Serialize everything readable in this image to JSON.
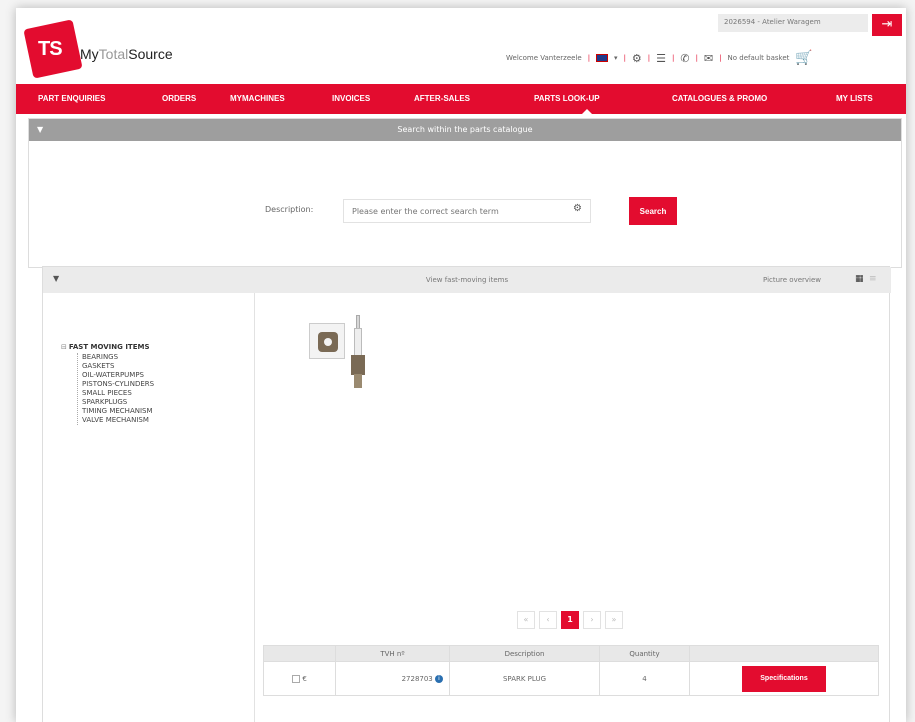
{
  "header": {
    "logo_text": "TS",
    "brand_part1": "My",
    "brand_part2": "Total",
    "brand_part3": "Source",
    "account": "2026594 - Atelier Waragem",
    "welcome": "Welcome Vanterzeele",
    "language": "EN",
    "basket": "No default basket"
  },
  "nav": {
    "items": [
      "PART ENQUIRIES",
      "ORDERS",
      "MYMACHINES",
      "INVOICES",
      "AFTER-SALES",
      "PARTS LOOK-UP",
      "CATALOGUES & PROMO",
      "MY LISTS"
    ]
  },
  "search": {
    "header": "Search within the parts catalogue",
    "label": "Description:",
    "placeholder": "Please enter the correct search term",
    "button": "Search"
  },
  "fast_moving": {
    "header": "View fast-moving items",
    "picture_overview": "Picture overview",
    "tree_root": "FAST MOVING ITEMS",
    "tree_items": [
      "BEARINGS",
      "GASKETS",
      "OIL-WATERPUMPS",
      "PISTONS-CYLINDERS",
      "SMALL PIECES",
      "SPARKPLUGS",
      "TIMING MECHANISM",
      "VALVE MECHANISM"
    ]
  },
  "pager": {
    "first": "«",
    "prev": "‹",
    "current": "1",
    "next": "›",
    "last": "»"
  },
  "table": {
    "headers": [
      "",
      "TVH nº",
      "Description",
      "Quantity",
      ""
    ],
    "rows": [
      {
        "currency": "€",
        "tvh": "2728703",
        "description": "SPARK PLUG",
        "quantity": "4",
        "action": "Specifications"
      }
    ]
  },
  "colors": {
    "accent": "#e30c2f",
    "panel_header": "#9e9e9e"
  },
  "icons": [
    "logout-icon",
    "flag-icon",
    "gear-icon",
    "list-icon",
    "phone-icon",
    "mail-icon",
    "cart-icon",
    "grid-view-icon",
    "list-view-icon",
    "info-icon"
  ]
}
